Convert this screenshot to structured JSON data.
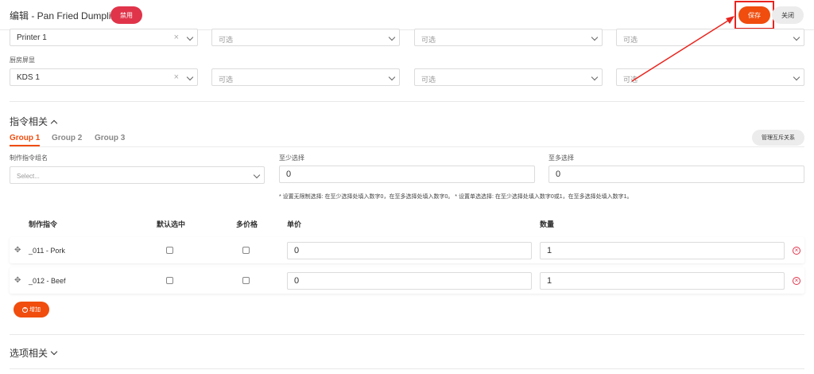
{
  "header": {
    "title": "编辑 - Pan Fried Dumpling",
    "disable_label": "禁用",
    "save_label": "保存",
    "close_label": "关闭"
  },
  "printer_row": {
    "primary_value": "Printer 1",
    "optional_placeholder": "可选",
    "clear_glyph": "×"
  },
  "kds": {
    "label": "厨房屏显",
    "primary_value": "KDS 1",
    "optional_placeholder": "可选",
    "clear_glyph": "×"
  },
  "instructions": {
    "title": "指令相关",
    "tabs": [
      {
        "label": "Group 1",
        "active": true
      },
      {
        "label": "Group 2",
        "active": false
      },
      {
        "label": "Group 3",
        "active": false
      }
    ],
    "manage_label": "管理互斥关系",
    "group_name_label": "制作指令组名",
    "group_name_placeholder": "Select...",
    "min_label": "至少选择",
    "min_value": "0",
    "max_label": "至多选择",
    "max_value": "0",
    "hint": "* 设置无限制选择: 在至少选择处填入数字0，在至多选择处填入数字0。 * 设置单选选择: 在至少选择处填入数字0或1，在至多选择处填入数字1。",
    "columns": {
      "instruction": "制作指令",
      "default": "默认选中",
      "multi_price": "多价格",
      "unit_price": "单价",
      "quantity": "数量"
    },
    "rows": [
      {
        "name": "_011 - Pork",
        "default_checked": false,
        "multi_price": false,
        "price": "0",
        "quantity": "1"
      },
      {
        "name": "_012 - Beef",
        "default_checked": false,
        "multi_price": false,
        "price": "0",
        "quantity": "1"
      }
    ],
    "add_label": "增加"
  },
  "options": {
    "title": "选项相关"
  },
  "colors": {
    "accent": "#f04d0e",
    "danger": "#e0344a",
    "annotation": "#e8251f"
  }
}
